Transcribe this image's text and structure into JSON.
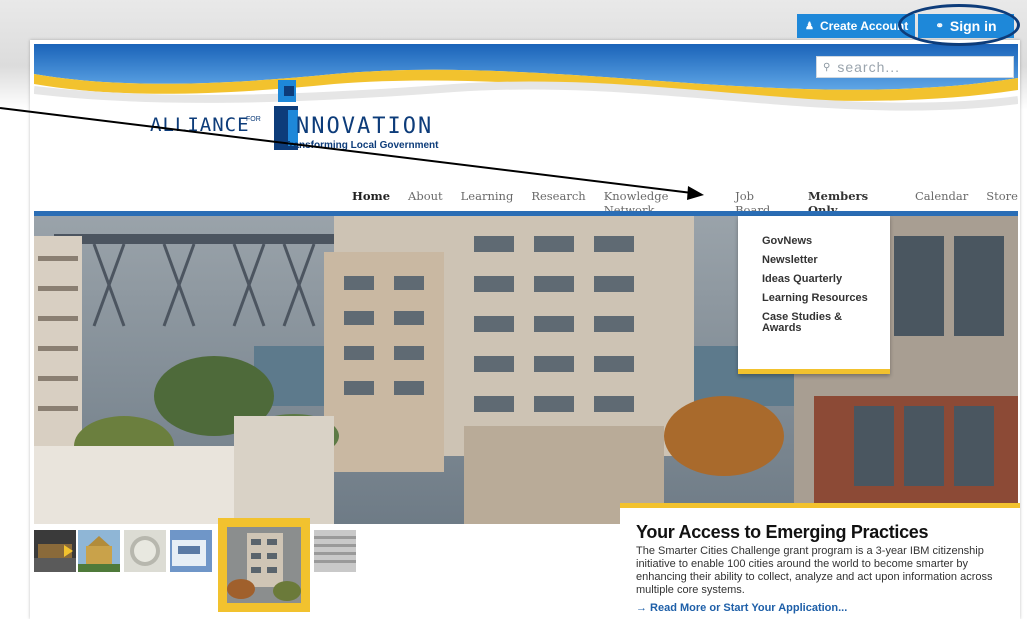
{
  "account": {
    "create_label": "Create Account",
    "signin_label": "Sign in"
  },
  "search": {
    "placeholder": "search..."
  },
  "logo": {
    "alliance": "ALLIANCE",
    "for": "FOR",
    "innovation": "NNOVATION",
    "tagline": "Transforming Local Government"
  },
  "nav": {
    "items": [
      "Home",
      "About",
      "Learning",
      "Research",
      "Knowledge Network",
      "Job Board",
      "Members Only",
      "Calendar",
      "Store"
    ],
    "active": "Home"
  },
  "dropdown": {
    "items": [
      "GovNews",
      "Newsletter",
      "Ideas Quarterly",
      "Learning Resources",
      "Case Studies & Awards"
    ]
  },
  "feature": {
    "title": "Your Access to Emerging Practices",
    "body": "The Smarter Cities Challenge grant program is a 3-year IBM citizenship initiative to enable 100 cities around the world to become smarter by enhancing their ability to collect, analyze and act upon information across multiple core systems.",
    "link": "→ Read More or Start Your Application..."
  },
  "colors": {
    "accent_blue": "#1e88d9",
    "nav_rule": "#2a6db5",
    "accent_yellow": "#f2c22e",
    "brand_navy": "#0d3c7a"
  },
  "icons": {
    "create_account": "user-icon",
    "sign_in": "key-icon",
    "search": "search-icon"
  }
}
